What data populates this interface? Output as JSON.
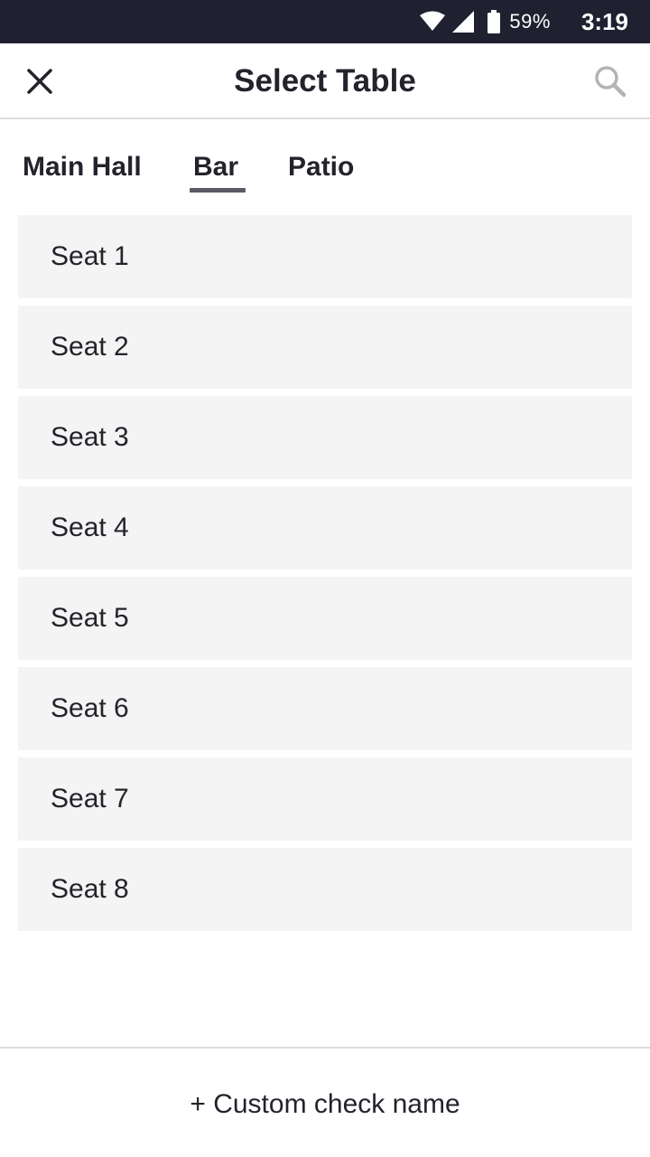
{
  "status_bar": {
    "battery_percent": "59%",
    "time": "3:19",
    "icons": [
      "wifi-icon",
      "signal-icon",
      "battery-icon"
    ]
  },
  "app_bar": {
    "title": "Select Table",
    "left_icon": "close-icon",
    "right_icon": "search-icon"
  },
  "tabs": {
    "items": [
      {
        "label": "Main Hall",
        "selected": false
      },
      {
        "label": "Bar",
        "selected": true
      },
      {
        "label": "Patio",
        "selected": false
      }
    ]
  },
  "seats": [
    {
      "label": "Seat 1"
    },
    {
      "label": "Seat 2"
    },
    {
      "label": "Seat 3"
    },
    {
      "label": "Seat 4"
    },
    {
      "label": "Seat 5"
    },
    {
      "label": "Seat 6"
    },
    {
      "label": "Seat 7"
    },
    {
      "label": "Seat 8"
    }
  ],
  "footer": {
    "custom_check_label": "+ Custom check name"
  },
  "colors": {
    "status_bar_bg": "#1f2030",
    "text": "#22232b",
    "row_bg": "#f4f4f4",
    "divider": "#dcdcdc",
    "tab_indicator": "#5a5a66"
  }
}
